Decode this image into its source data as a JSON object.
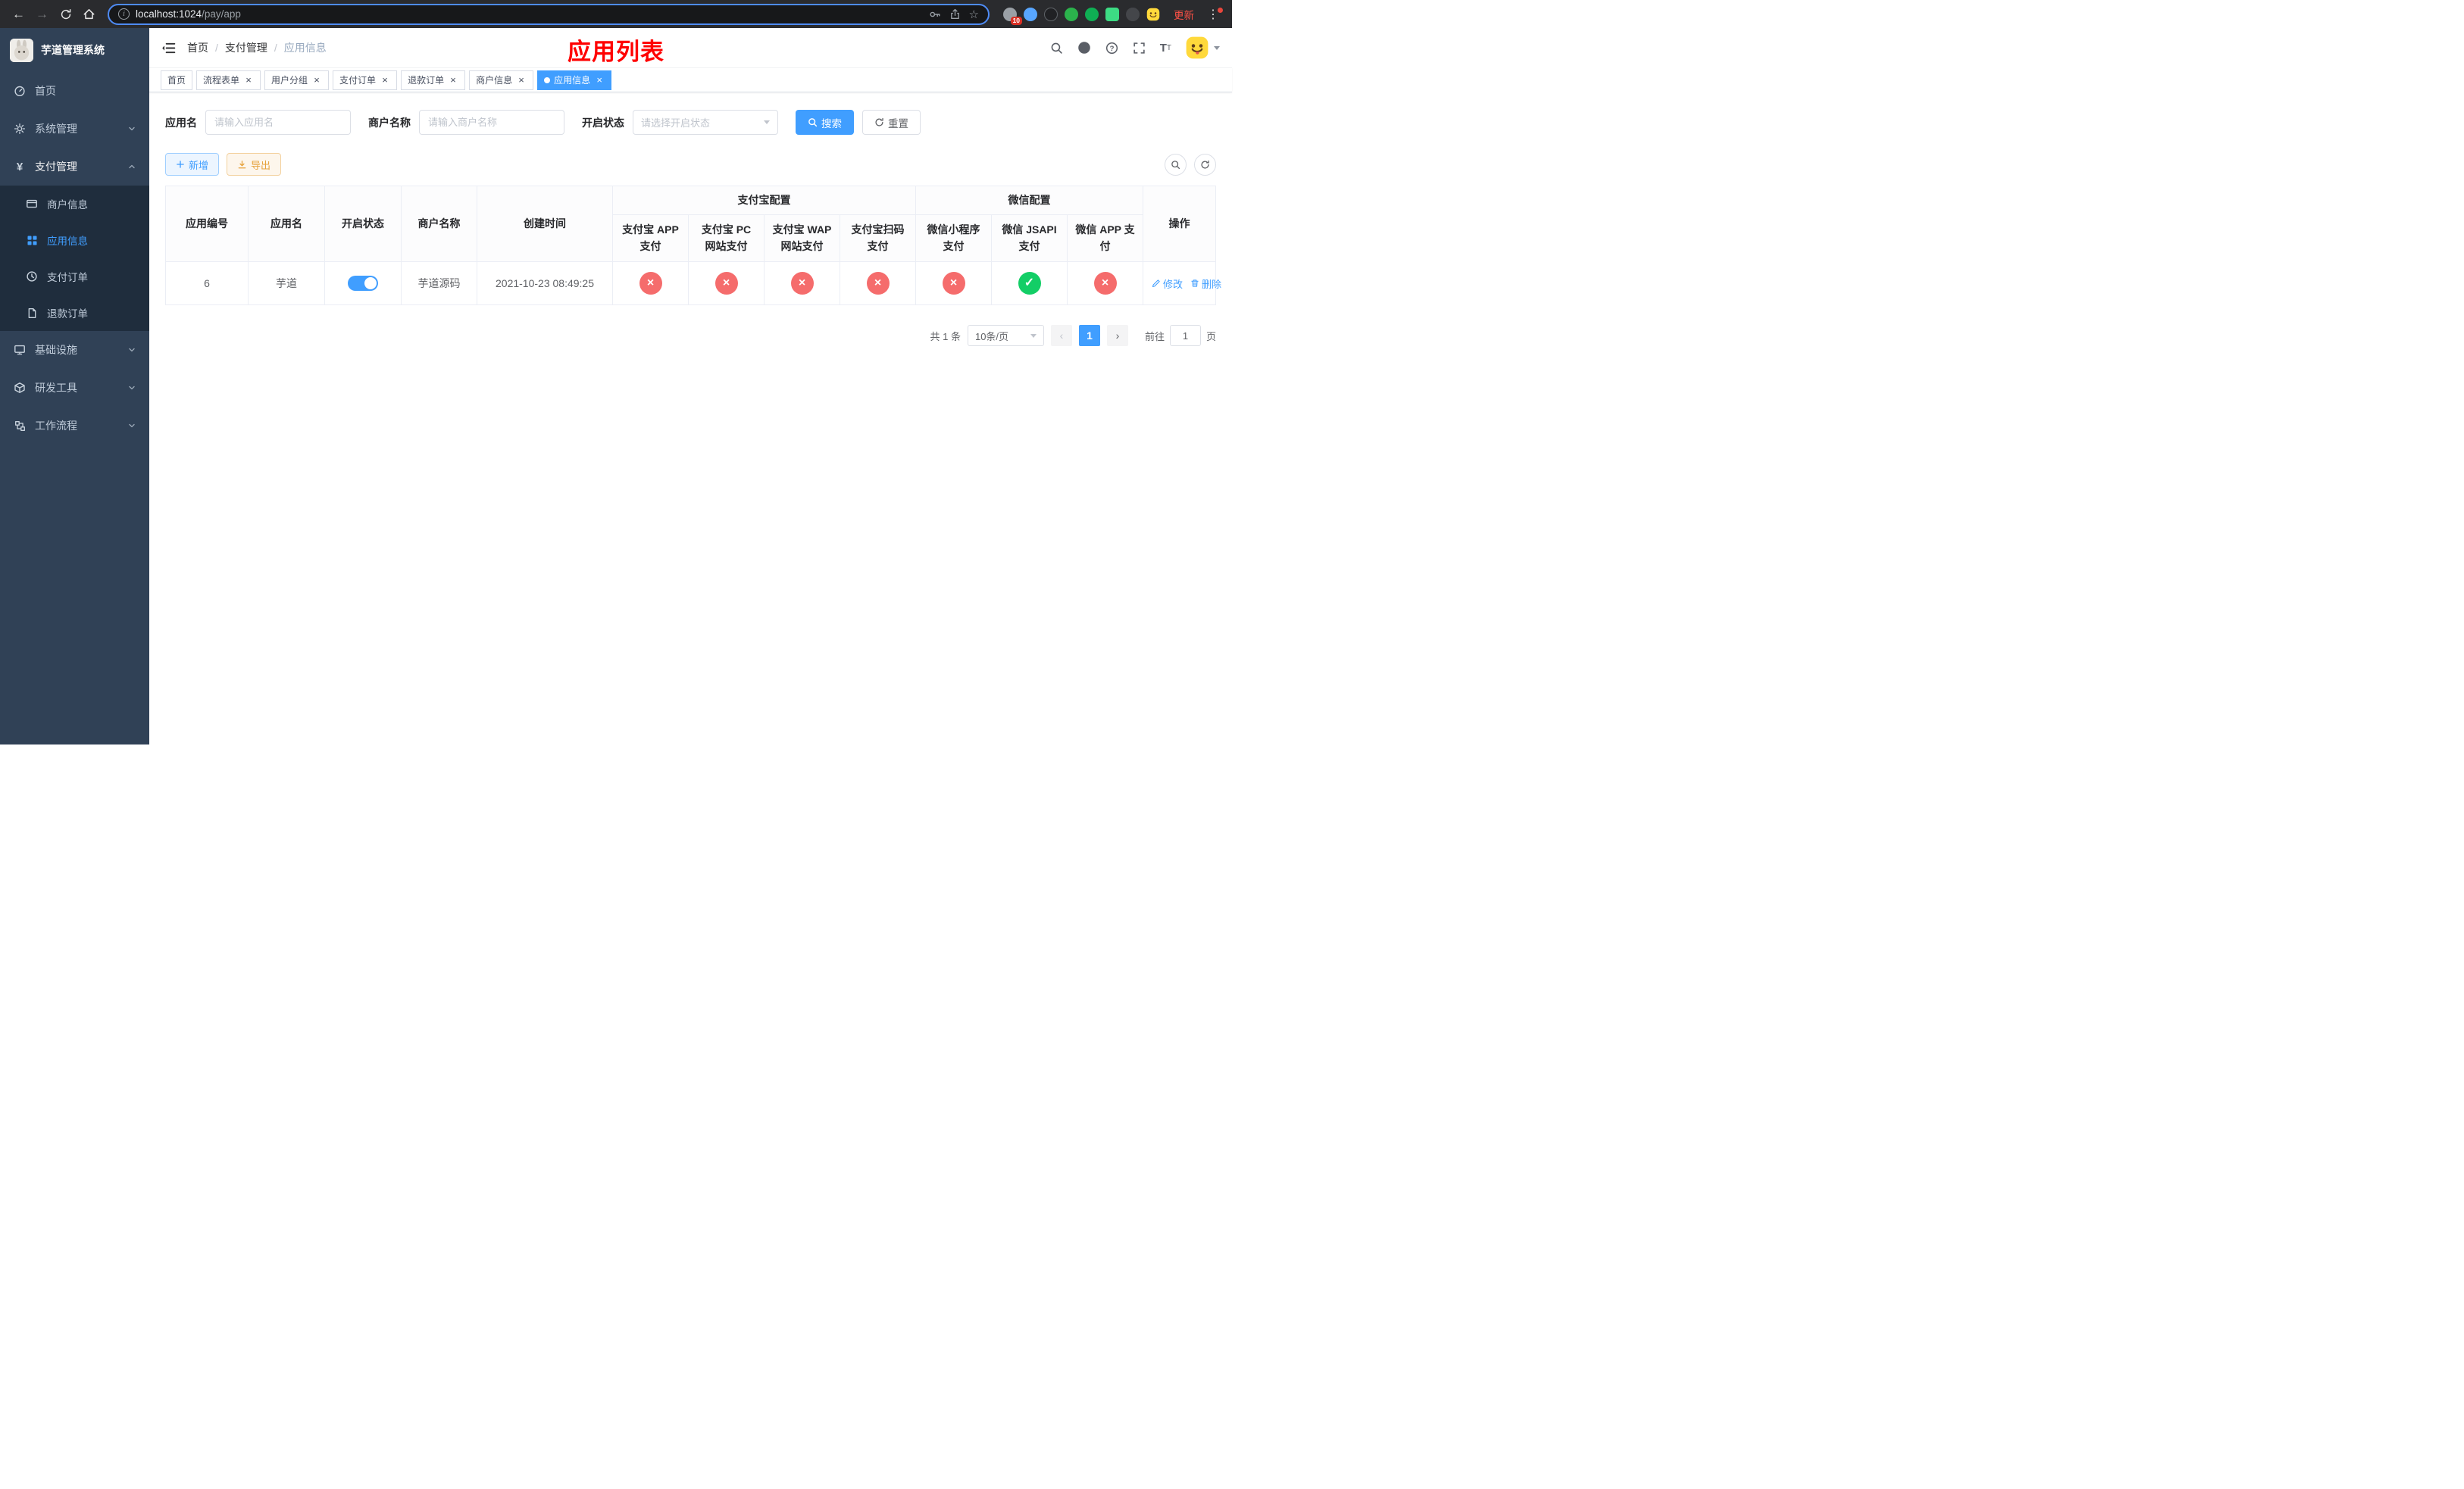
{
  "colors": {
    "accent": "#409eff",
    "danger": "#f56c6c",
    "success": "#13ce66",
    "warning": "#e6a23c",
    "title_red": "#ff0000",
    "sidebar_bg": "#304156",
    "submenu_bg": "#1f2d3d"
  },
  "browser": {
    "url_host": "localhost:1024",
    "url_path": "/pay/app",
    "update_label": "更新",
    "extension_badge": "10"
  },
  "sidebar": {
    "app_title": "芋道管理系统",
    "items": [
      {
        "label": "首页"
      },
      {
        "label": "系统管理"
      },
      {
        "label": "支付管理",
        "children": [
          {
            "label": "商户信息"
          },
          {
            "label": "应用信息"
          },
          {
            "label": "支付订单"
          },
          {
            "label": "退款订单"
          }
        ]
      },
      {
        "label": "基础设施"
      },
      {
        "label": "研发工具"
      },
      {
        "label": "工作流程"
      }
    ]
  },
  "header": {
    "breadcrumb": [
      "首页",
      "支付管理",
      "应用信息"
    ],
    "page_title": "应用列表"
  },
  "tabs": [
    {
      "label": "首页"
    },
    {
      "label": "流程表单"
    },
    {
      "label": "用户分组"
    },
    {
      "label": "支付订单"
    },
    {
      "label": "退款订单"
    },
    {
      "label": "商户信息"
    },
    {
      "label": "应用信息"
    }
  ],
  "filters": {
    "app_name_label": "应用名",
    "app_name_placeholder": "请输入应用名",
    "merchant_label": "商户名称",
    "merchant_placeholder": "请输入商户名称",
    "status_label": "开启状态",
    "status_placeholder": "请选择开启状态",
    "search_label": "搜索",
    "reset_label": "重置"
  },
  "toolbar": {
    "add_label": "新增",
    "export_label": "导出"
  },
  "table": {
    "group_alipay": "支付宝配置",
    "group_wechat": "微信配置",
    "columns": [
      "应用编号",
      "应用名",
      "开启状态",
      "商户名称",
      "创建时间",
      "支付宝 APP 支付",
      "支付宝 PC 网站支付",
      "支付宝 WAP 网站支付",
      "支付宝扫码支付",
      "微信小程序支付",
      "微信 JSAPI 支付",
      "微信 APP 支付",
      "操作"
    ],
    "rows": [
      {
        "id": "6",
        "app_name": "芋道",
        "status_on": true,
        "merchant": "芋道源码",
        "created_at": "2021-10-23 08:49:25",
        "configs": {
          "alipay_app": false,
          "alipay_pc": false,
          "alipay_wap": false,
          "alipay_qr": false,
          "wechat_mini": false,
          "wechat_jsapi": true,
          "wechat_app": false
        },
        "edit_label": "修改",
        "delete_label": "删除"
      }
    ]
  },
  "pagination": {
    "total_text": "共 1 条",
    "page_size": "10条/页",
    "current_page": "1",
    "goto_label": "前往",
    "goto_value": "1",
    "goto_unit": "页"
  }
}
